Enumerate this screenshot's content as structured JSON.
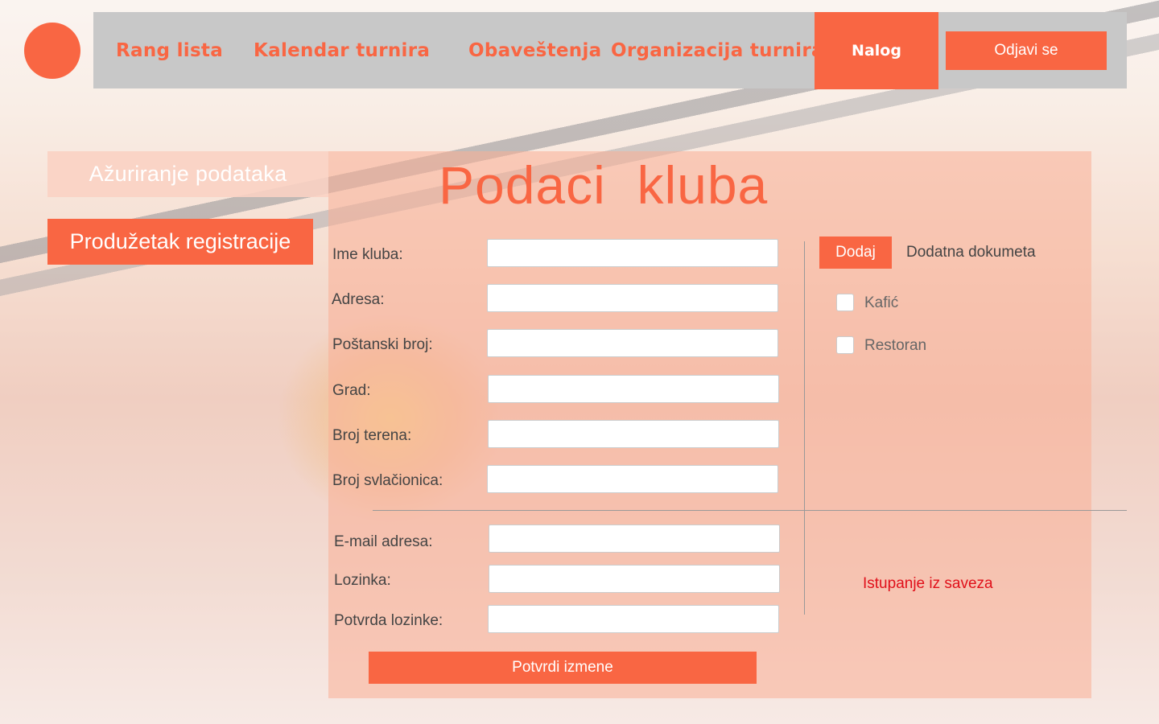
{
  "colors": {
    "accent": "#f96643",
    "nav_bg": "#c8c8c8",
    "danger": "#e0101a"
  },
  "logo": {
    "icon": "circle-logo-icon"
  },
  "nav": {
    "items": [
      "Rang lista",
      "Kalendar turnira",
      "Obaveštenja",
      "Organizacija turnira"
    ],
    "active": "Nalog",
    "logout": "Odjavi se"
  },
  "sidebar": {
    "update_label": "Ažuriranje podataka",
    "extension_label": "Produžetak registracije"
  },
  "form": {
    "title": "Podaci  kluba",
    "fields": [
      {
        "label": "Ime kluba:",
        "value": ""
      },
      {
        "label": "Adresa:",
        "value": ""
      },
      {
        "label": "Poštanski broj:",
        "value": ""
      },
      {
        "label": "Grad:",
        "value": ""
      },
      {
        "label": "Broj terena:",
        "value": ""
      },
      {
        "label": "Broj svlačionica:",
        "value": ""
      }
    ],
    "account_fields": [
      {
        "label": "E-mail adresa:",
        "value": ""
      },
      {
        "label": "Lozinka:",
        "value": ""
      },
      {
        "label": "Potvrda lozinke:",
        "value": ""
      }
    ],
    "confirm_label": "Potvrdi izmene"
  },
  "extras": {
    "add_label": "Dodaj",
    "docs_label": "Dodatna dokumeta",
    "options": [
      {
        "label": "Kafić",
        "checked": false
      },
      {
        "label": "Restoran",
        "checked": false
      }
    ],
    "withdraw_label": "Istupanje iz saveza"
  }
}
